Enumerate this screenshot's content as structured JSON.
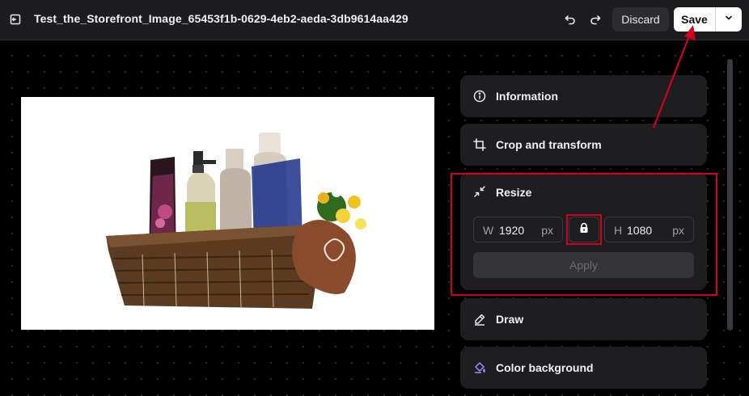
{
  "header": {
    "title": "Test_the_Storefront_Image_65453f1b-0629-4eb2-aeda-3db9614aa429",
    "exit_icon": "exit-icon",
    "undo_icon": "undo-icon",
    "redo_icon": "redo-icon",
    "discard_label": "Discard",
    "save_label": "Save",
    "save_menu_icon": "chevron-down-icon"
  },
  "canvas": {
    "image_alt": "Storefront product image: wicker basket with cosmetic bottles and flowers"
  },
  "panel": {
    "information": {
      "label": "Information",
      "icon": "info-icon"
    },
    "crop": {
      "label": "Crop and transform",
      "icon": "crop-icon"
    },
    "resize": {
      "label": "Resize",
      "icon": "shrink-icon",
      "width_prefix": "W",
      "width_value": "1920",
      "width_unit": "px",
      "height_prefix": "H",
      "height_value": "1080",
      "height_unit": "px",
      "lock_icon": "lock-icon",
      "apply_label": "Apply"
    },
    "draw": {
      "label": "Draw",
      "icon": "pen-icon"
    },
    "color_background": {
      "label": "Color background",
      "icon": "paint-bucket-icon"
    }
  },
  "colors": {
    "topbar_bg": "#1d1d20",
    "panel_bg": "#1e1e21",
    "annotation_red": "#d0021b",
    "color_background_icon": "#a08cff"
  }
}
